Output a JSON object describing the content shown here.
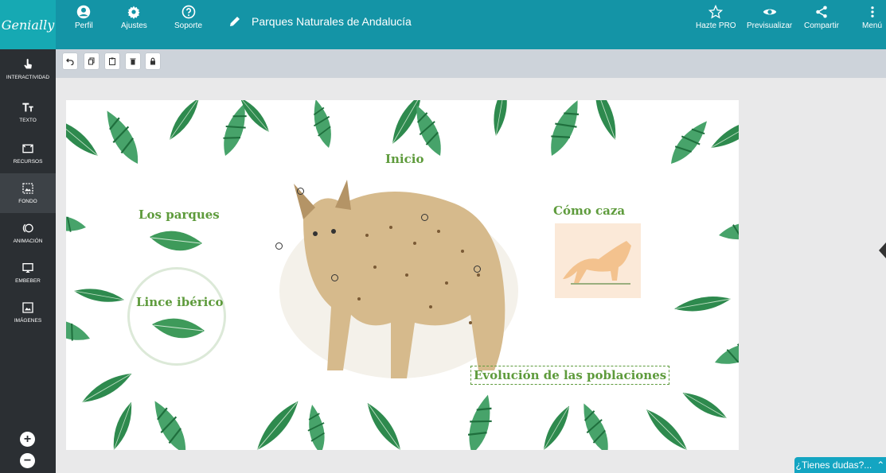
{
  "header": {
    "logo": "Genially",
    "buttons": [
      {
        "label": "Perfil",
        "icon": "user-icon"
      },
      {
        "label": "Ajustes",
        "icon": "gear-icon"
      },
      {
        "label": "Soporte",
        "icon": "help-icon"
      }
    ],
    "doc_title": "Parques Naturales de Andalucía",
    "right_buttons": [
      {
        "label": "Hazte PRO",
        "icon": "star-icon"
      },
      {
        "label": "Previsualizar",
        "icon": "eye-icon"
      },
      {
        "label": "Compartir",
        "icon": "share-icon"
      },
      {
        "label": "Menú",
        "icon": "more-vertical-icon"
      }
    ]
  },
  "sidebar": {
    "items": [
      {
        "label": "INTERACTIVIDAD",
        "icon": "pointer-hand-icon"
      },
      {
        "label": "TEXTO",
        "icon": "text-icon"
      },
      {
        "label": "RECURSOS",
        "icon": "resources-icon"
      },
      {
        "label": "FONDO",
        "icon": "background-icon"
      },
      {
        "label": "ANIMACIÓN",
        "icon": "animation-icon"
      },
      {
        "label": "EMBEBER",
        "icon": "embed-icon"
      },
      {
        "label": "IMÁGENES",
        "icon": "image-icon"
      }
    ],
    "zoom_in": "+",
    "zoom_out": "−"
  },
  "toolbar": {
    "buttons": [
      "undo-icon",
      "copy-icon",
      "paste-icon",
      "delete-icon",
      "lock-icon"
    ]
  },
  "canvas": {
    "title_inicio": "Inicio",
    "title_parques": "Los parques",
    "title_lince": "Lince ibérico",
    "title_caza": "Cómo caza",
    "title_evolucion": "Evolución de las poblaciones"
  },
  "help": {
    "label": "¿Tienes dudas?..."
  },
  "colors": {
    "header": "#1494a6",
    "sidebar": "#2b2f33",
    "accent_green": "#5e9b3c"
  }
}
